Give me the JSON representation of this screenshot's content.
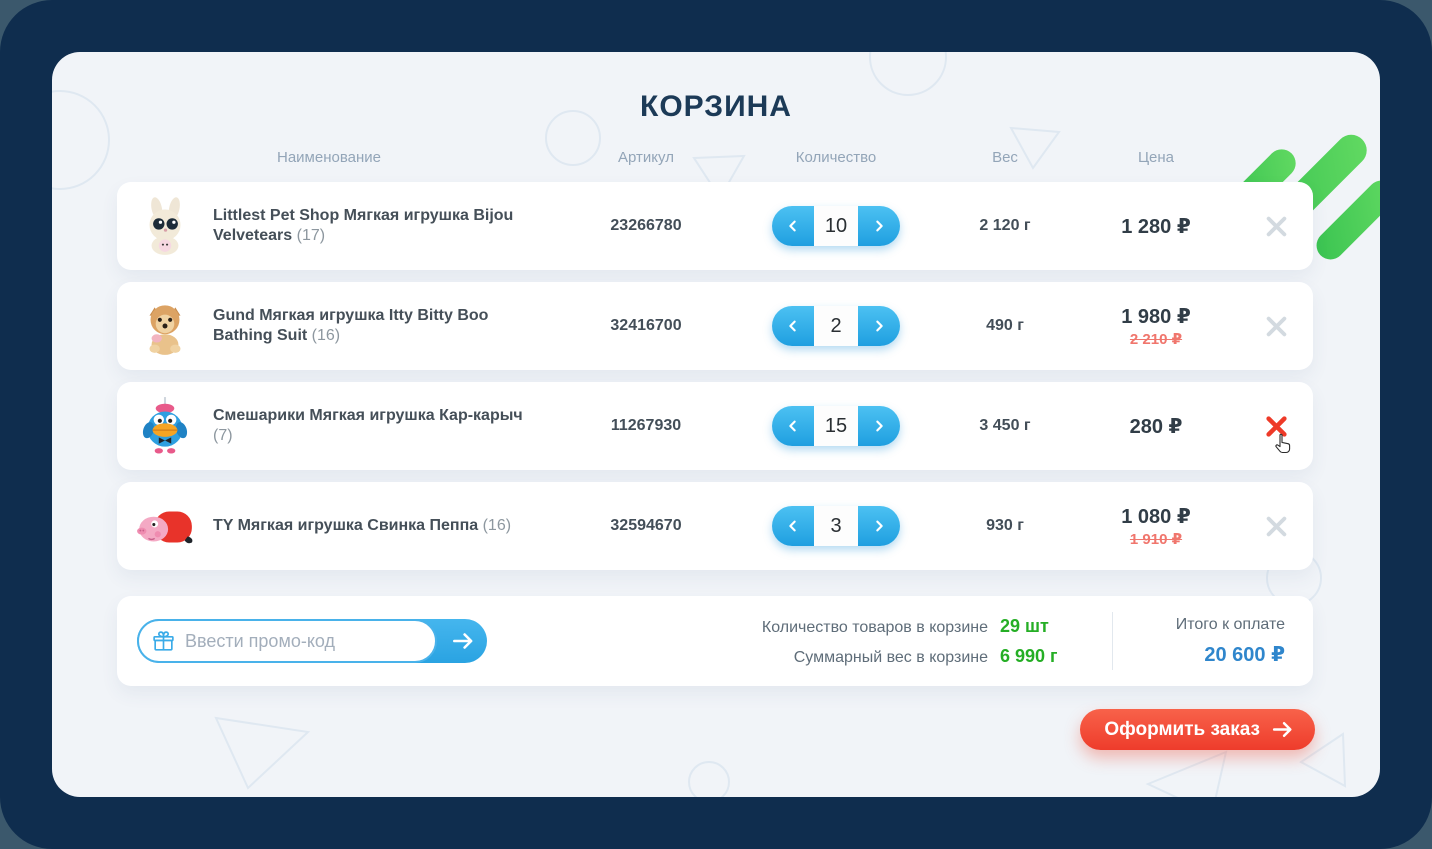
{
  "page": {
    "title": "КОРЗИНА"
  },
  "table": {
    "headers": {
      "name": "Наименование",
      "article": "Артикул",
      "quantity": "Количество",
      "weight": "Вес",
      "price": "Цена"
    },
    "rows": [
      {
        "name": "Littlest Pet Shop Мягкая игрушка Bijou Velvetears",
        "count": "(17)",
        "article": "23266780",
        "qty": "10",
        "weight": "2 120 г",
        "price": "1 280 ₽",
        "old_price": ""
      },
      {
        "name": "Gund Мягкая игрушка Itty Bitty Boo Bathing Suit",
        "count": "(16)",
        "article": "32416700",
        "qty": "2",
        "weight": "490 г",
        "price": "1 980 ₽",
        "old_price": "2 210 ₽"
      },
      {
        "name": "Смешарики Мягкая игрушка Кар-карыч",
        "count": "(7)",
        "article": "11267930",
        "qty": "15",
        "weight": "3 450 г",
        "price": "280 ₽",
        "old_price": ""
      },
      {
        "name": "TY Мягкая игрушка Свинка Пеппа",
        "count": "(16)",
        "article": "32594670",
        "qty": "3",
        "weight": "930 г",
        "price": "1 080 ₽",
        "old_price": "1 910 ₽"
      }
    ]
  },
  "summary": {
    "promo_placeholder": "Ввести промо-код",
    "items_label": "Количество товаров в корзине",
    "items_value": "29 шт",
    "weight_label": "Суммарный вес в корзине",
    "weight_value": "6 990 г",
    "total_label": "Итого к оплате",
    "total_value": "20 600 ₽"
  },
  "checkout": {
    "label": "Оформить заказ"
  },
  "colors": {
    "frame_navy": "#0f2d4e",
    "panel_bg": "#f1f4f8",
    "accent_blue": "#2aa3e2",
    "accent_green": "#25ae25",
    "accent_red": "#ee3c2b",
    "old_price_red": "#f0766d",
    "total_blue": "#2f86cc"
  }
}
